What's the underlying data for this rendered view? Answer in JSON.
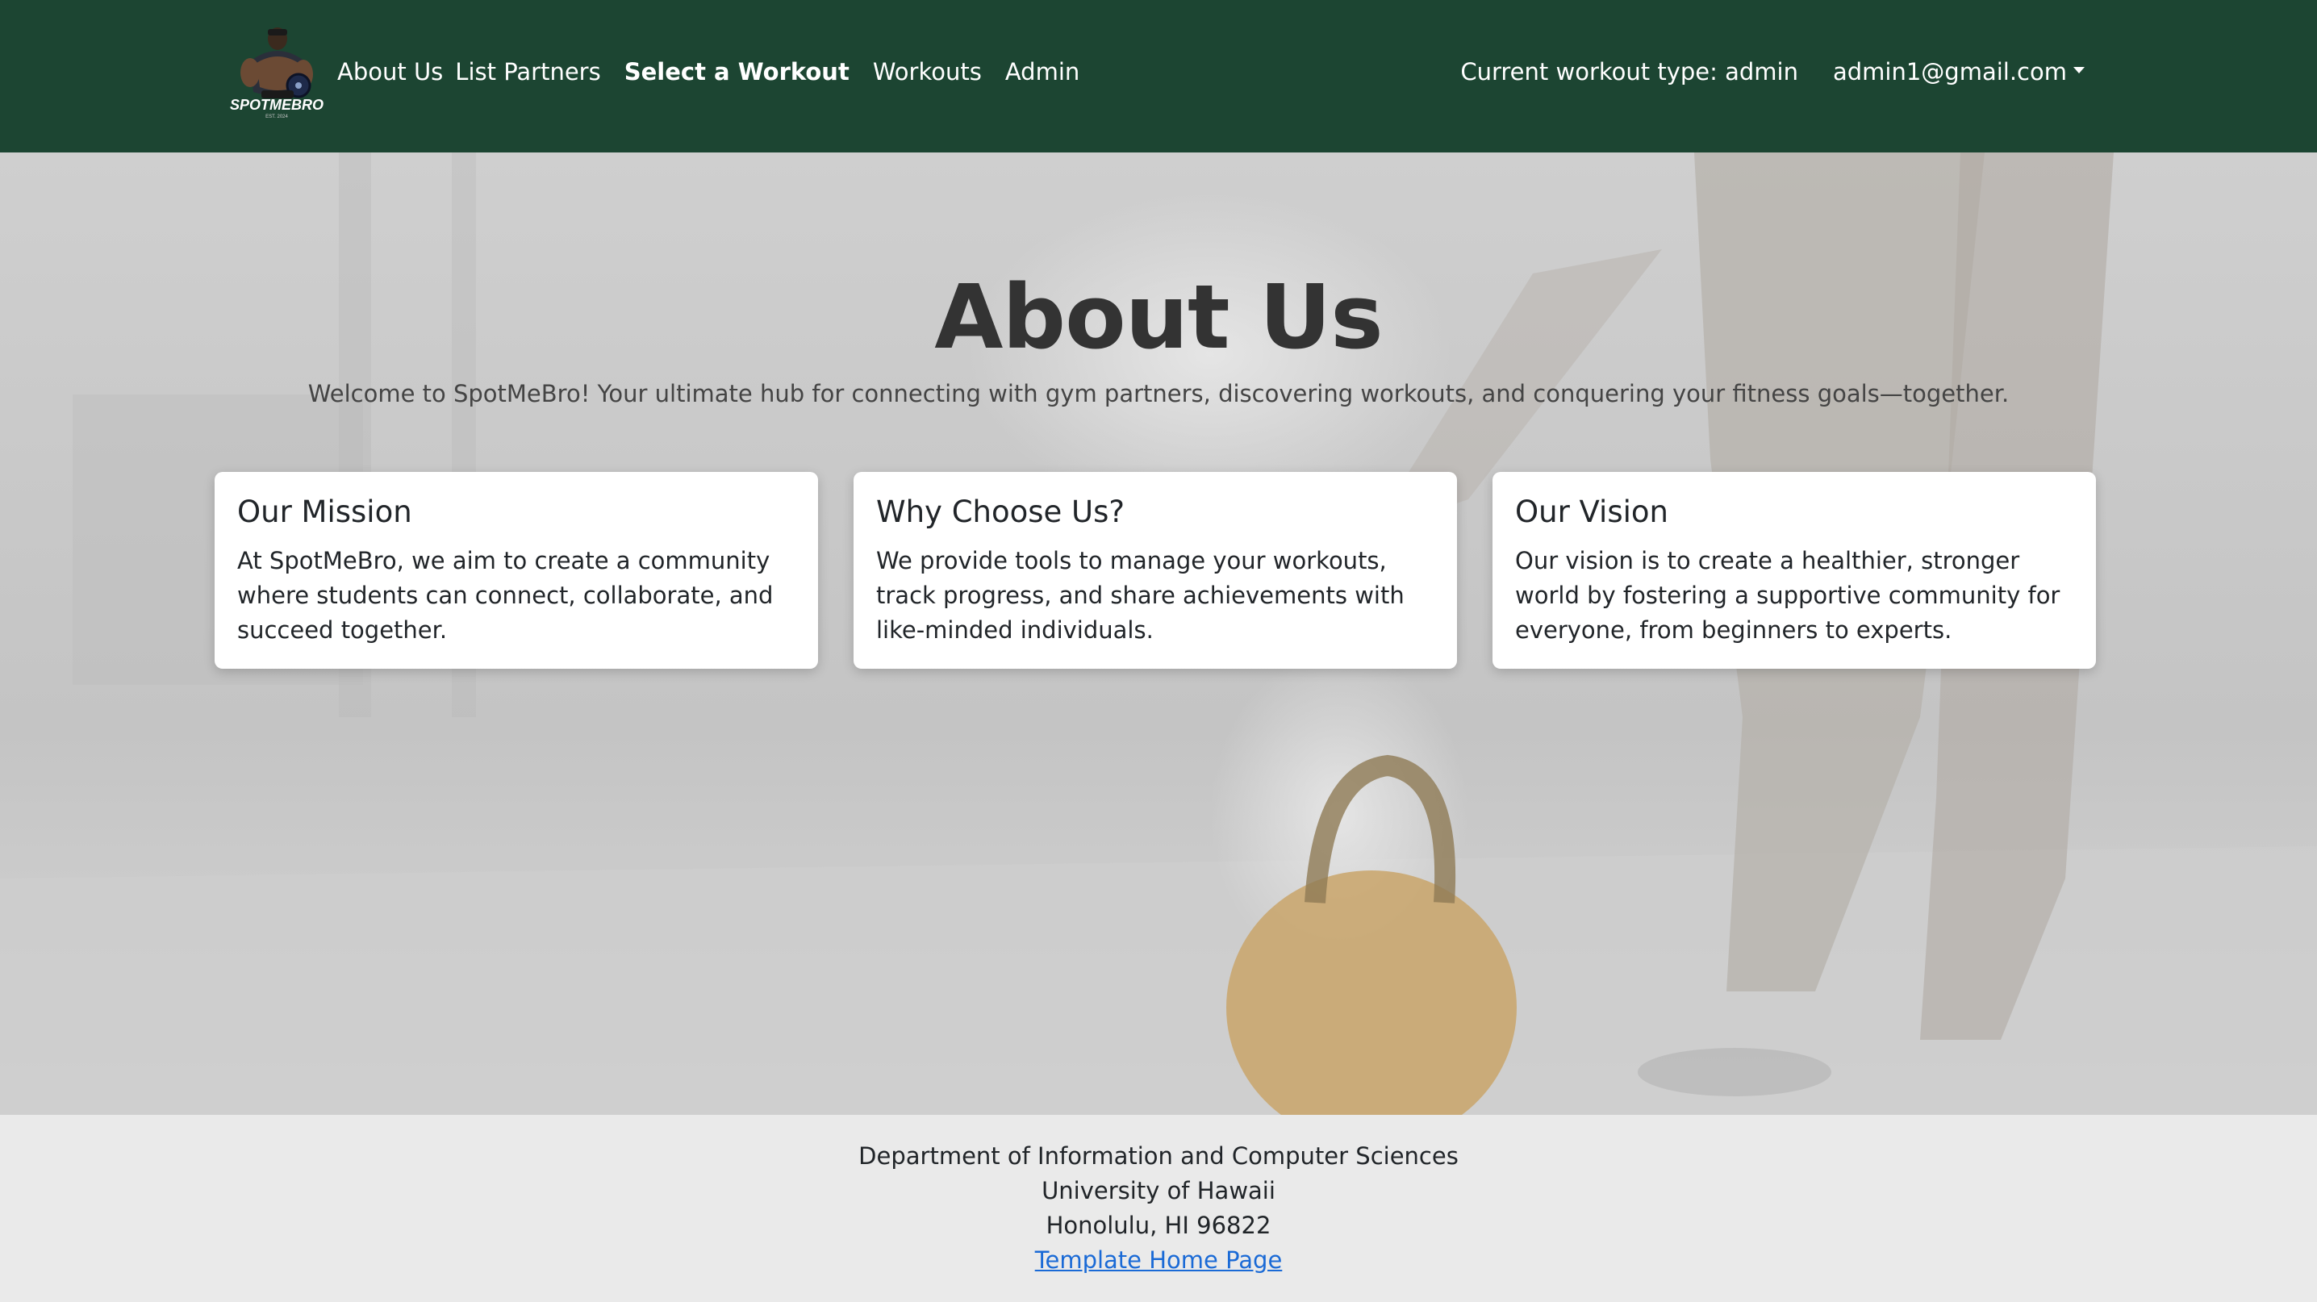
{
  "navbar": {
    "brand_text": "SPOTMEBRO",
    "brand_tagline": "EST. 2024",
    "links": [
      "About Us",
      "List Partners",
      "Select a Workout",
      "Workouts",
      "Admin"
    ],
    "workout_type": "Current workout type: admin",
    "user_email": "admin1@gmail.com"
  },
  "hero": {
    "title": "About Us",
    "subtitle": "Welcome to SpotMeBro! Your ultimate hub for connecting with gym partners, discovering workouts, and conquering your fitness goals—together."
  },
  "cards": [
    {
      "title": "Our Mission",
      "body": "At SpotMeBro, we aim to create a community where students can connect, collaborate, and succeed together."
    },
    {
      "title": "Why Choose Us?",
      "body": "We provide tools to manage your workouts, track progress, and share achievements with like-minded individuals."
    },
    {
      "title": "Our Vision",
      "body": "Our vision is to create a healthier, stronger world by fostering a supportive community for everyone, from beginners to experts."
    }
  ],
  "footer": {
    "line1": "Department of Information and Computer Sciences",
    "line2": "University of Hawaii",
    "line3": "Honolulu, HI 96822",
    "link_text": "Template Home Page"
  },
  "colors": {
    "navbar_bg": "#1c4532",
    "footer_bg": "#eaeaea",
    "link": "#1a6ad6"
  }
}
